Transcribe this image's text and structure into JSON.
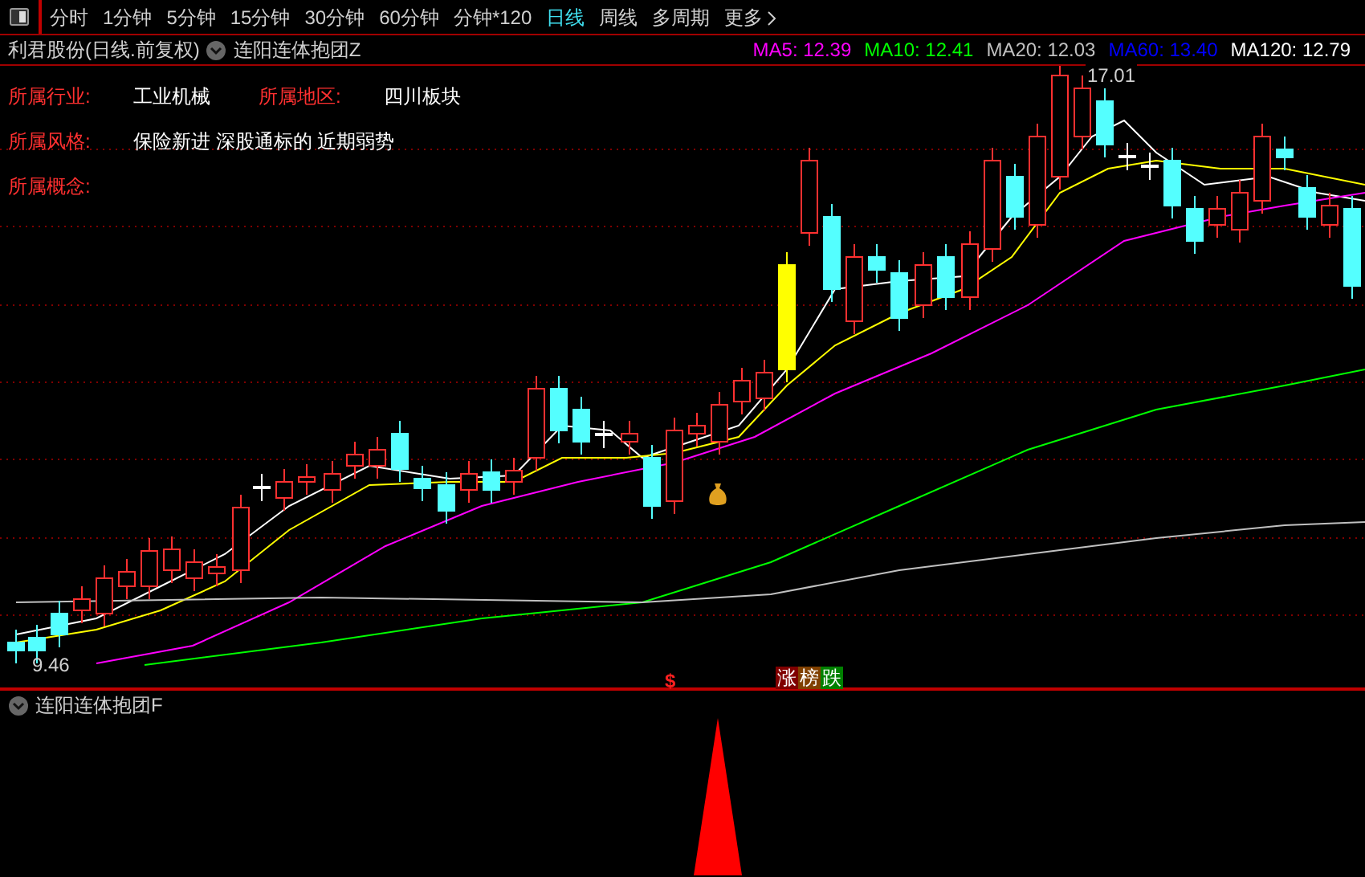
{
  "toolbar": {
    "tabs": [
      {
        "label": "分时",
        "selected": false
      },
      {
        "label": "1分钟",
        "selected": false
      },
      {
        "label": "5分钟",
        "selected": false
      },
      {
        "label": "15分钟",
        "selected": false
      },
      {
        "label": "30分钟",
        "selected": false
      },
      {
        "label": "60分钟",
        "selected": false
      },
      {
        "label": "分钟*120",
        "selected": false
      },
      {
        "label": "日线",
        "selected": true
      },
      {
        "label": "周线",
        "selected": false
      },
      {
        "label": "多周期",
        "selected": false
      },
      {
        "label": "更多",
        "selected": false
      }
    ]
  },
  "legend": {
    "title": "利君股份(日线.前复权)",
    "indicator": "连阳连体抱团Z",
    "averages": [
      {
        "label": "MA5: 12.39",
        "kind": "ma5"
      },
      {
        "label": "MA10: 12.41",
        "kind": "ma10"
      },
      {
        "label": "MA20: 12.03",
        "kind": "ma20"
      },
      {
        "label": "MA60: 13.40",
        "kind": "ma60"
      },
      {
        "label": "MA120: 12.79",
        "kind": "ma120"
      }
    ]
  },
  "info": [
    {
      "label": "所属行业:",
      "value": "工业机械"
    },
    {
      "label": "所属地区:",
      "value": "四川板块"
    },
    {
      "label": "所属风格:",
      "value": "保险新进 深股通标的 近期弱势"
    },
    {
      "label": "所属概念:"
    }
  ],
  "price_high": "17.01",
  "price_low": "9.46",
  "markers": {
    "signal": "$",
    "tags": [
      {
        "label": "涨",
        "color": "#800000"
      },
      {
        "label": "榜",
        "color": "#804000"
      },
      {
        "label": "跌",
        "color": "#008000"
      }
    ]
  },
  "lower_panel": {
    "title": "连阳连体抱团F"
  }
}
